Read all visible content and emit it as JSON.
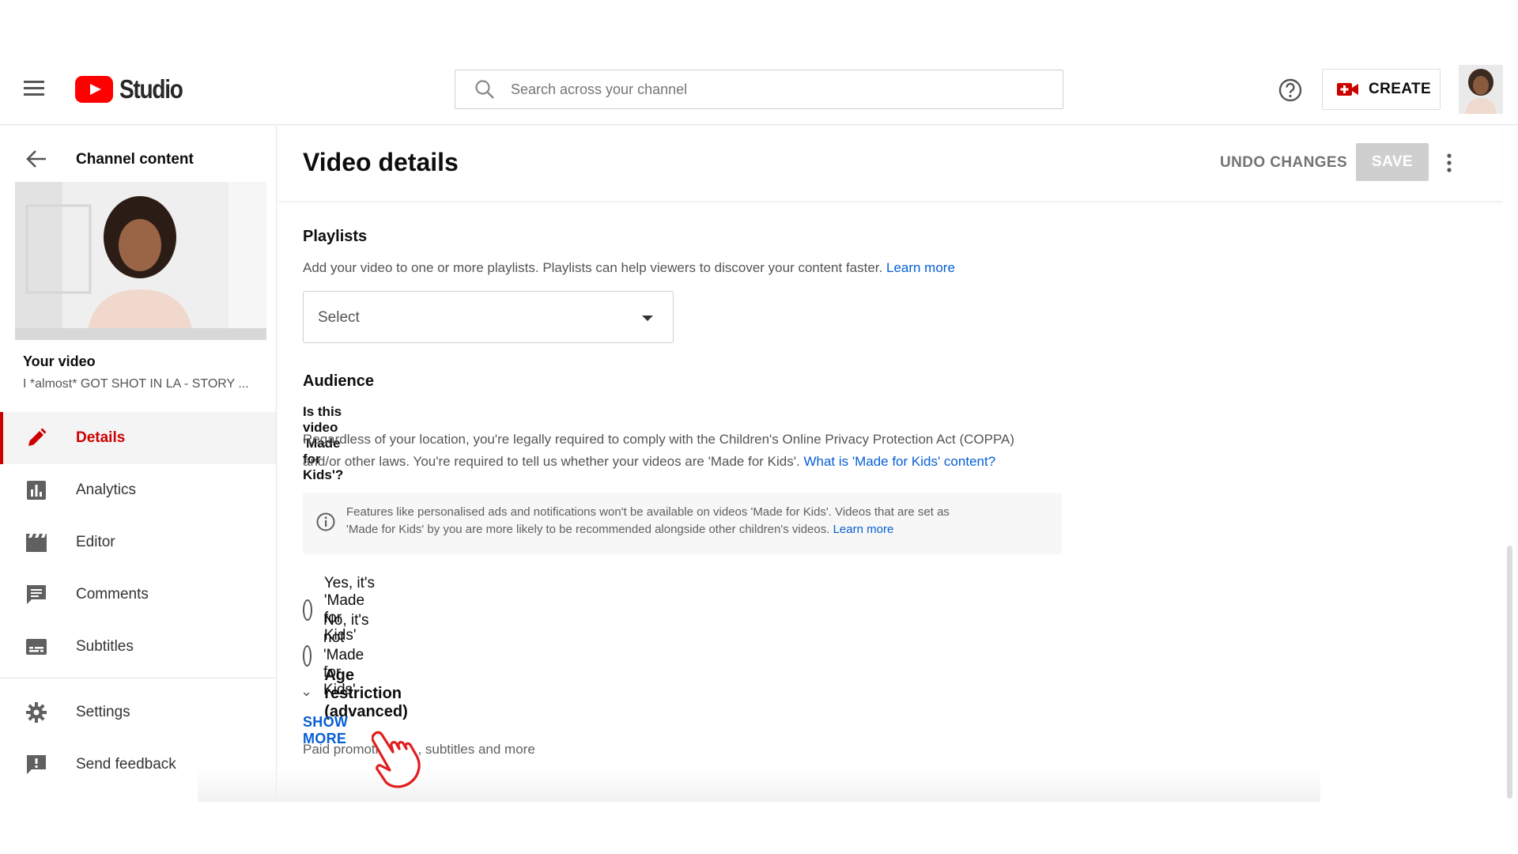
{
  "header": {
    "logo_text": "Studio",
    "search_placeholder": "Search across your channel",
    "create_label": "CREATE"
  },
  "sidebar": {
    "back_title": "Channel content",
    "your_video_label": "Your video",
    "video_title": "I *almost* GOT SHOT IN LA - STORY ...",
    "items": [
      {
        "label": "Details",
        "icon": "pencil-icon",
        "active": true
      },
      {
        "label": "Analytics",
        "icon": "analytics-icon",
        "active": false
      },
      {
        "label": "Editor",
        "icon": "editor-icon",
        "active": false
      },
      {
        "label": "Comments",
        "icon": "comments-icon",
        "active": false
      },
      {
        "label": "Subtitles",
        "icon": "subtitles-icon",
        "active": false
      }
    ],
    "bottom_items": [
      {
        "label": "Settings",
        "icon": "gear-icon"
      },
      {
        "label": "Send feedback",
        "icon": "feedback-icon"
      }
    ]
  },
  "main": {
    "page_title": "Video details",
    "undo_label": "UNDO CHANGES",
    "save_label": "SAVE",
    "playlists": {
      "title": "Playlists",
      "description": "Add your video to one or more playlists. Playlists can help viewers to discover your content faster.",
      "learn_more": "Learn more",
      "select_value": "Select"
    },
    "audience": {
      "title": "Audience",
      "question": "Is this video 'Made for Kids'?",
      "desc_line1": "Regardless of your location, you're legally required to comply with the Children's Online Privacy Protection Act (COPPA)",
      "desc_line2": "and/or other laws. You're required to tell us whether your videos are 'Made for Kids'.",
      "desc_link": "What is 'Made for Kids' content?",
      "info_line1": "Features like personalised ads and notifications won't be available on videos 'Made for Kids'. Videos that are set as",
      "info_line2": "'Made for Kids' by you are more likely to be recommended alongside other children's videos.",
      "info_link": "Learn more",
      "option_yes": "Yes, it's 'Made for Kids'",
      "option_no": "No, it's not 'Made for Kids'"
    },
    "age_restriction": "Age restriction (advanced)",
    "show_more": "SHOW MORE",
    "show_more_sub_a": "Paid promoti",
    "show_more_sub_b": ", subtitles and more"
  },
  "colors": {
    "accent_red": "#cc0000",
    "link_blue": "#065fd4",
    "save_disabled": "#cfcfcf"
  }
}
